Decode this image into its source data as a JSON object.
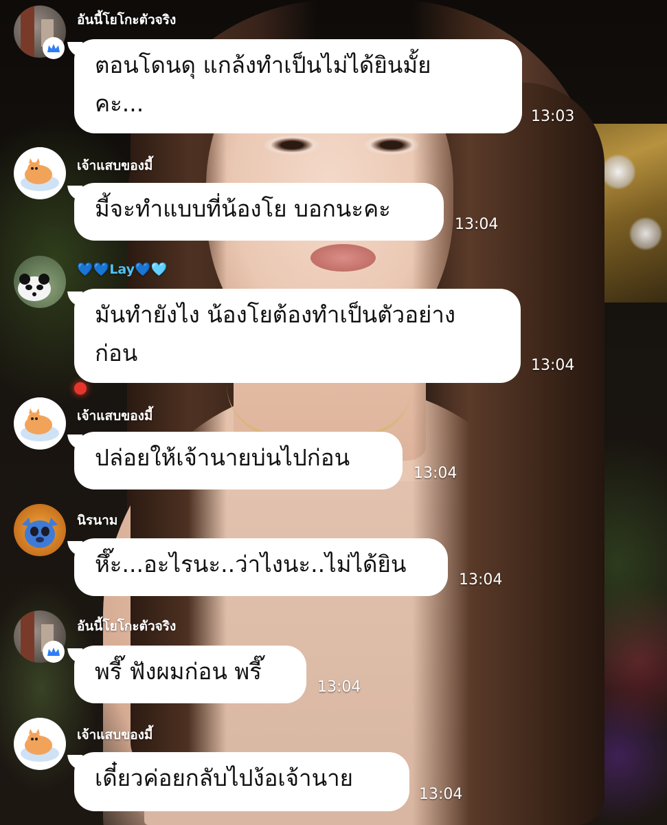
{
  "messages": [
    {
      "sender": "อันนี้โยโกะตัวจริง",
      "text": "ตอนโดนดุ แกล้งทำเป็นไม่ได้ยินมั้ย\nคะ...",
      "time": "13:03",
      "avatar": "photo-avatar",
      "badge": "crown-icon"
    },
    {
      "sender": "เจ้าแสบของมี้",
      "text": "มี้จะทำแบบที่น้องโย บอกนะคะ",
      "time": "13:04",
      "avatar": "cat-sticker-avatar"
    },
    {
      "sender": "💙💙Lay💙🩵",
      "text": "มันทำยังไง น้องโยต้องทำเป็นตัวอย่าง\nก่อน",
      "time": "13:04",
      "avatar": "panda-avatar"
    },
    {
      "sender": "เจ้าแสบของมี้",
      "text": "ปล่อยให้เจ้านายบ่นไปก่อน",
      "time": "13:04",
      "avatar": "cat-sticker-avatar"
    },
    {
      "sender": "นิรนาม",
      "text": "หึ๊ะ...อะไรนะ..ว่าไงนะ..ไม่ได้ยิน",
      "time": "13:04",
      "avatar": "stitch-avatar"
    },
    {
      "sender": "อันนี้โยโกะตัวจริง",
      "text": "พรี๊ ฟังผมก่อน พรี๊",
      "time": "13:04",
      "avatar": "photo-avatar",
      "badge": "crown-icon"
    },
    {
      "sender": "เจ้าแสบของมี้",
      "text": "เดี๋ยวค่อยกลับไปง้อเจ้านาย",
      "time": "13:04",
      "avatar": "cat-sticker-avatar"
    }
  ],
  "colors": {
    "bubble": "#ffffff",
    "text": "#111111",
    "meta": "#ffffff",
    "badge": "#2f7df6"
  }
}
